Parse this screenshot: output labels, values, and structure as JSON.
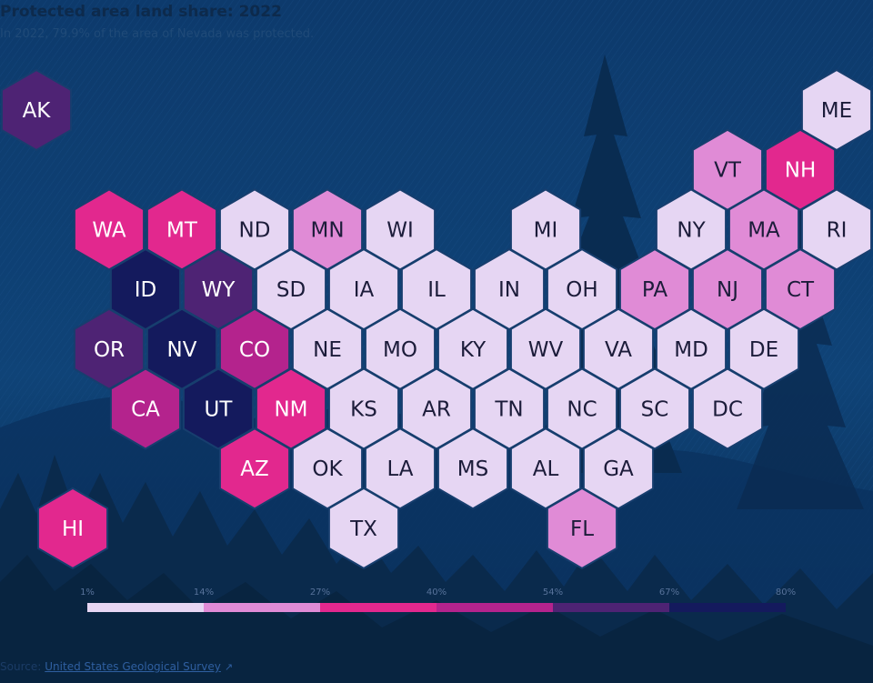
{
  "header": {
    "title": "Protected area land share: 2022",
    "subtitle": "In 2022, 79.9% of the area of Nevada was protected."
  },
  "legend": {
    "ticks": [
      "1%",
      "14%",
      "27%",
      "40%",
      "54%",
      "67%",
      "80%"
    ],
    "colors": [
      "#e6d6f3",
      "#e08bd6",
      "#e2288e",
      "#b4238d",
      "#4e2374",
      "#141a5d"
    ]
  },
  "source": {
    "label": "Source:",
    "link_text": "United States Geological Survey",
    "icon": "external-link-icon"
  },
  "background": {
    "theme": "forest-silhouette",
    "colors": [
      "#0e3a6a",
      "#0a2848"
    ]
  },
  "states": [
    {
      "abbr": "AK",
      "row": 0,
      "col": 0,
      "bin": 4
    },
    {
      "abbr": "ME",
      "row": 0,
      "col": 11,
      "bin": 0
    },
    {
      "abbr": "VT",
      "row": 1,
      "col": 9.5,
      "bin": 1
    },
    {
      "abbr": "NH",
      "row": 1,
      "col": 10.5,
      "bin": 2
    },
    {
      "abbr": "WA",
      "row": 2,
      "col": 1,
      "bin": 2
    },
    {
      "abbr": "MT",
      "row": 2,
      "col": 2,
      "bin": 2
    },
    {
      "abbr": "ND",
      "row": 2,
      "col": 3,
      "bin": 0
    },
    {
      "abbr": "MN",
      "row": 2,
      "col": 4,
      "bin": 1
    },
    {
      "abbr": "WI",
      "row": 2,
      "col": 5,
      "bin": 0
    },
    {
      "abbr": "MI",
      "row": 2,
      "col": 7,
      "bin": 0
    },
    {
      "abbr": "NY",
      "row": 2,
      "col": 9,
      "bin": 0
    },
    {
      "abbr": "MA",
      "row": 2,
      "col": 10,
      "bin": 1
    },
    {
      "abbr": "RI",
      "row": 2,
      "col": 11,
      "bin": 0
    },
    {
      "abbr": "ID",
      "row": 3,
      "col": 1.5,
      "bin": 5
    },
    {
      "abbr": "WY",
      "row": 3,
      "col": 2.5,
      "bin": 4
    },
    {
      "abbr": "SD",
      "row": 3,
      "col": 3.5,
      "bin": 0
    },
    {
      "abbr": "IA",
      "row": 3,
      "col": 4.5,
      "bin": 0
    },
    {
      "abbr": "IL",
      "row": 3,
      "col": 5.5,
      "bin": 0
    },
    {
      "abbr": "IN",
      "row": 3,
      "col": 6.5,
      "bin": 0
    },
    {
      "abbr": "OH",
      "row": 3,
      "col": 7.5,
      "bin": 0
    },
    {
      "abbr": "PA",
      "row": 3,
      "col": 8.5,
      "bin": 1
    },
    {
      "abbr": "NJ",
      "row": 3,
      "col": 9.5,
      "bin": 1
    },
    {
      "abbr": "CT",
      "row": 3,
      "col": 10.5,
      "bin": 1
    },
    {
      "abbr": "OR",
      "row": 4,
      "col": 1,
      "bin": 4
    },
    {
      "abbr": "NV",
      "row": 4,
      "col": 2,
      "bin": 5
    },
    {
      "abbr": "CO",
      "row": 4,
      "col": 3,
      "bin": 3
    },
    {
      "abbr": "NE",
      "row": 4,
      "col": 4,
      "bin": 0
    },
    {
      "abbr": "MO",
      "row": 4,
      "col": 5,
      "bin": 0
    },
    {
      "abbr": "KY",
      "row": 4,
      "col": 6,
      "bin": 0
    },
    {
      "abbr": "WV",
      "row": 4,
      "col": 7,
      "bin": 0
    },
    {
      "abbr": "VA",
      "row": 4,
      "col": 8,
      "bin": 0
    },
    {
      "abbr": "MD",
      "row": 4,
      "col": 9,
      "bin": 0
    },
    {
      "abbr": "DE",
      "row": 4,
      "col": 10,
      "bin": 0
    },
    {
      "abbr": "CA",
      "row": 5,
      "col": 1.5,
      "bin": 3
    },
    {
      "abbr": "UT",
      "row": 5,
      "col": 2.5,
      "bin": 5
    },
    {
      "abbr": "NM",
      "row": 5,
      "col": 3.5,
      "bin": 2
    },
    {
      "abbr": "KS",
      "row": 5,
      "col": 4.5,
      "bin": 0
    },
    {
      "abbr": "AR",
      "row": 5,
      "col": 5.5,
      "bin": 0
    },
    {
      "abbr": "TN",
      "row": 5,
      "col": 6.5,
      "bin": 0
    },
    {
      "abbr": "NC",
      "row": 5,
      "col": 7.5,
      "bin": 0
    },
    {
      "abbr": "SC",
      "row": 5,
      "col": 8.5,
      "bin": 0
    },
    {
      "abbr": "DC",
      "row": 5,
      "col": 9.5,
      "bin": 0
    },
    {
      "abbr": "AZ",
      "row": 6,
      "col": 3,
      "bin": 2
    },
    {
      "abbr": "OK",
      "row": 6,
      "col": 4,
      "bin": 0
    },
    {
      "abbr": "LA",
      "row": 6,
      "col": 5,
      "bin": 0
    },
    {
      "abbr": "MS",
      "row": 6,
      "col": 6,
      "bin": 0
    },
    {
      "abbr": "AL",
      "row": 6,
      "col": 7,
      "bin": 0
    },
    {
      "abbr": "GA",
      "row": 6,
      "col": 8,
      "bin": 0
    },
    {
      "abbr": "HI",
      "row": 7,
      "col": 0.5,
      "bin": 2
    },
    {
      "abbr": "TX",
      "row": 7,
      "col": 4.5,
      "bin": 0
    },
    {
      "abbr": "FL",
      "row": 7,
      "col": 7.5,
      "bin": 1
    }
  ]
}
